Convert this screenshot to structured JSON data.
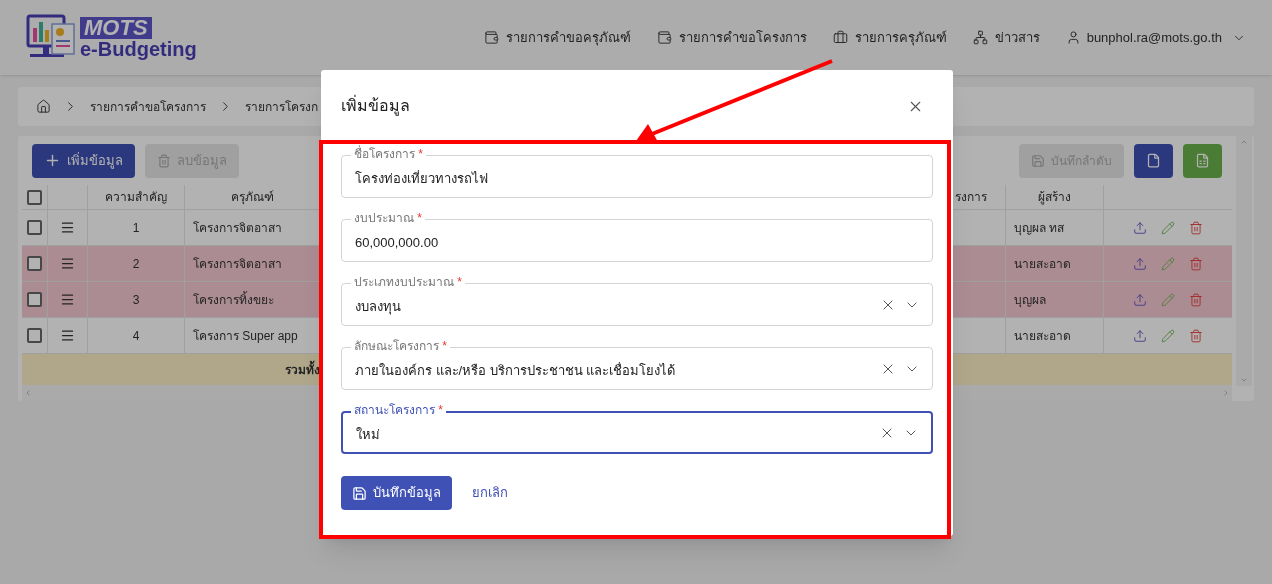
{
  "header": {
    "logo": {
      "top": "MOTS",
      "bottom": "e-Budgeting"
    },
    "nav": [
      {
        "label": "รายการคำขอครุภัณฑ์"
      },
      {
        "label": "รายการคำขอโครงการ"
      },
      {
        "label": "รายการครุภัณฑ์"
      },
      {
        "label": "ข่าวสาร"
      }
    ],
    "user": "bunphol.ra@mots.go.th"
  },
  "breadcrumb": [
    "รายการคำขอโครงการ",
    "รายการโครงก"
  ],
  "toolbar": {
    "add": "เพิ่มข้อมูล",
    "delete": "ลบข้อมูล",
    "save_order": "บันทึกลำดับ"
  },
  "table": {
    "all_checked": false,
    "columns": [
      "ความสำคัญ",
      "ครุภัณฑ์",
      "รงการ",
      "ผู้สร้าง"
    ],
    "rows": [
      {
        "checked": false,
        "order": "1",
        "name": "โครงการจิตอาสา",
        "creator": "บุญผล ทส",
        "highlighted": false
      },
      {
        "checked": false,
        "order": "2",
        "name": "โครงการจิตอาสา",
        "creator": "นายสะอาด",
        "highlighted": true
      },
      {
        "checked": false,
        "order": "3",
        "name": "โครงการทิ้งขยะ",
        "creator": "บุญผล",
        "highlighted": true
      },
      {
        "checked": false,
        "order": "4",
        "name": "โครงการ Super app",
        "creator": "นายสะอาด",
        "highlighted": false
      }
    ],
    "total_label": "รวมทั้ง"
  },
  "dialog": {
    "title": "เพิ่มข้อมูล",
    "fields": [
      {
        "kind": "text",
        "label": "ชื่อโครงการ",
        "value": "โครงท่องเที่ยวทางรถไฟ",
        "required": "*",
        "focused": false
      },
      {
        "kind": "text",
        "label": "งบประมาณ",
        "value": "60,000,000.00",
        "required": "*",
        "focused": false
      },
      {
        "kind": "select",
        "label": "ประเภทงบประมาณ",
        "value": "งบลงทุน",
        "required": "*",
        "focused": false
      },
      {
        "kind": "select",
        "label": "ลักษณะโครงการ",
        "value": "ภายในองค์กร และ/หรือ บริการประชาชน และเชื่อมโยงได้",
        "required": "*",
        "focused": false
      },
      {
        "kind": "select",
        "label": "สถานะโครงการ",
        "value": "ใหม่",
        "required": "*",
        "focused": true
      }
    ],
    "save": "บันทึกข้อมูล",
    "cancel": "ยกเลิก"
  }
}
